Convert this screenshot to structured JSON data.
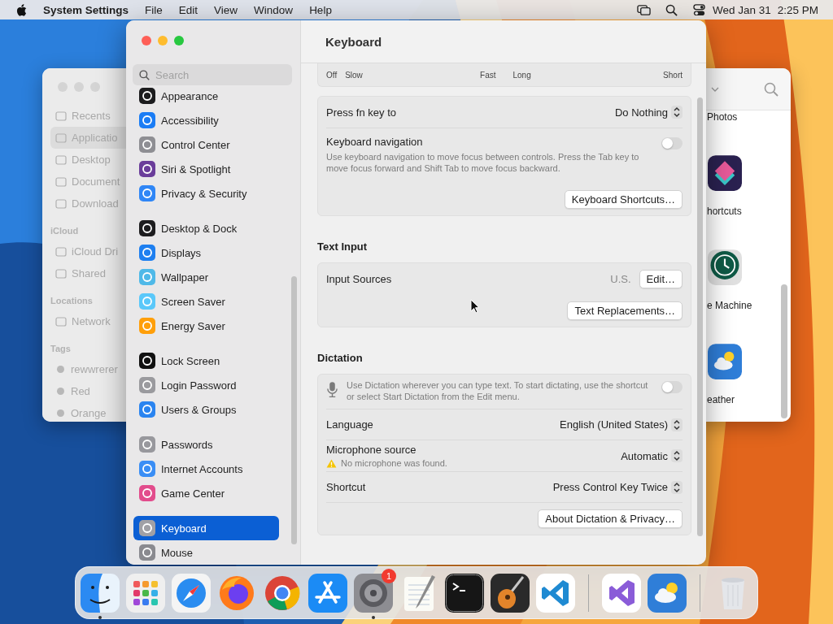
{
  "menu_bar": {
    "app": "System Settings",
    "menus": [
      "File",
      "Edit",
      "View",
      "Window",
      "Help"
    ],
    "date": "Wed Jan 31",
    "time": "2:25 PM"
  },
  "finder": {
    "sidebar": [
      {
        "kind": "places",
        "items": [
          {
            "label": "Recents",
            "selected": false
          },
          {
            "label": "Applicatio",
            "selected": true
          },
          {
            "label": "Desktop",
            "selected": false
          },
          {
            "label": "Document",
            "selected": false
          },
          {
            "label": "Download",
            "selected": false
          }
        ]
      },
      {
        "kind": "places",
        "heading": "iCloud",
        "items": [
          {
            "label": "iCloud Dri",
            "selected": false
          },
          {
            "label": "Shared",
            "selected": false
          }
        ]
      },
      {
        "kind": "places",
        "heading": "Locations",
        "items": [
          {
            "label": "Network",
            "selected": false
          }
        ]
      },
      {
        "kind": "tags",
        "heading": "Tags",
        "items": [
          {
            "label": "rewwrerer",
            "selected": false
          },
          {
            "label": "Red",
            "selected": false
          },
          {
            "label": "Orange",
            "selected": false
          }
        ]
      }
    ],
    "items": [
      {
        "label": "Photos"
      },
      {
        "label": "hortcuts"
      },
      {
        "label": "e Machine"
      },
      {
        "label": "eather"
      }
    ]
  },
  "settings": {
    "search": {
      "placeholder": "Search"
    },
    "sidebar": [
      {
        "items": [
          {
            "label": "Appearance",
            "color": "#1c1c1e",
            "selected": false
          },
          {
            "label": "Accessibility",
            "color": "#1a7cf5",
            "selected": false
          },
          {
            "label": "Control Center",
            "color": "#8e8e93",
            "selected": false
          },
          {
            "label": "Siri & Spotlight",
            "color": "#6a3d9a",
            "selected": false
          },
          {
            "label": "Privacy & Security",
            "color": "#2f86f6",
            "selected": false
          }
        ]
      },
      {
        "items": [
          {
            "label": "Desktop & Dock",
            "color": "#1d1d1f",
            "selected": false
          },
          {
            "label": "Displays",
            "color": "#1e7ff0",
            "selected": false
          },
          {
            "label": "Wallpaper",
            "color": "#4fb9e8",
            "selected": false
          },
          {
            "label": "Screen Saver",
            "color": "#5ac8fa",
            "selected": false
          },
          {
            "label": "Energy Saver",
            "color": "#ff9f0a",
            "selected": false
          }
        ]
      },
      {
        "items": [
          {
            "label": "Lock Screen",
            "color": "#111111",
            "selected": false
          },
          {
            "label": "Login Password",
            "color": "#9a9a9e",
            "selected": false
          },
          {
            "label": "Users & Groups",
            "color": "#2a84f0",
            "selected": false
          }
        ]
      },
      {
        "items": [
          {
            "label": "Passwords",
            "color": "#98989d",
            "selected": false
          },
          {
            "label": "Internet Accounts",
            "color": "#3a8ef5",
            "selected": false
          },
          {
            "label": "Game Center",
            "color": "#e24c8c",
            "selected": false
          }
        ]
      },
      {
        "items": [
          {
            "label": "Keyboard",
            "color": "#a0a0a5",
            "selected": true
          },
          {
            "label": "Mouse",
            "color": "#8a8a8f",
            "selected": false
          }
        ]
      }
    ],
    "title": "Keyboard",
    "sliders": [
      {
        "labels": [
          "Off",
          "Slow",
          "Fast"
        ]
      },
      {
        "labels": [
          "Long",
          "Short"
        ]
      }
    ],
    "sections": [
      {
        "rows": [
          {
            "kind": "popup",
            "label": "Press fn key to",
            "value": "Do Nothing"
          },
          {
            "kind": "toggle",
            "label": "Keyboard navigation",
            "description": "Use keyboard navigation to move focus between controls. Press the Tab key to move focus forward and Shift Tab to move focus backward.",
            "on": false
          },
          {
            "kind": "button",
            "button": "Keyboard Shortcuts…"
          }
        ]
      },
      {
        "heading": "Text Input",
        "rows": [
          {
            "kind": "value_button",
            "label": "Input Sources",
            "value": "U.S.",
            "button": "Edit…"
          },
          {
            "kind": "button",
            "button": "Text Replacements…"
          }
        ]
      },
      {
        "heading": "Dictation",
        "rows": [
          {
            "kind": "info_toggle",
            "description": "Use Dictation wherever you can type text. To start dictating, use the shortcut or select Start Dictation from the Edit menu.",
            "on": false
          },
          {
            "kind": "popup",
            "label": "Language",
            "value": "English (United States)"
          },
          {
            "kind": "popup",
            "label": "Microphone source",
            "value": "Automatic",
            "warning": "No microphone was found."
          },
          {
            "kind": "popup",
            "label": "Shortcut",
            "value": "Press Control Key Twice"
          },
          {
            "kind": "button",
            "button": "About Dictation & Privacy…"
          }
        ]
      }
    ]
  },
  "dock": {
    "sections": [
      {
        "items": [
          {
            "running": true
          },
          {
            "running": false
          },
          {
            "running": false
          },
          {
            "running": false
          },
          {
            "running": false
          },
          {
            "running": false
          },
          {
            "running": true,
            "badge": "1"
          },
          {
            "running": false
          },
          {
            "running": false
          },
          {
            "running": false
          },
          {
            "running": false
          }
        ]
      },
      {
        "items": [
          {
            "running": false
          },
          {
            "running": false
          }
        ]
      },
      {
        "items": [
          {
            "running": false
          }
        ]
      }
    ]
  }
}
